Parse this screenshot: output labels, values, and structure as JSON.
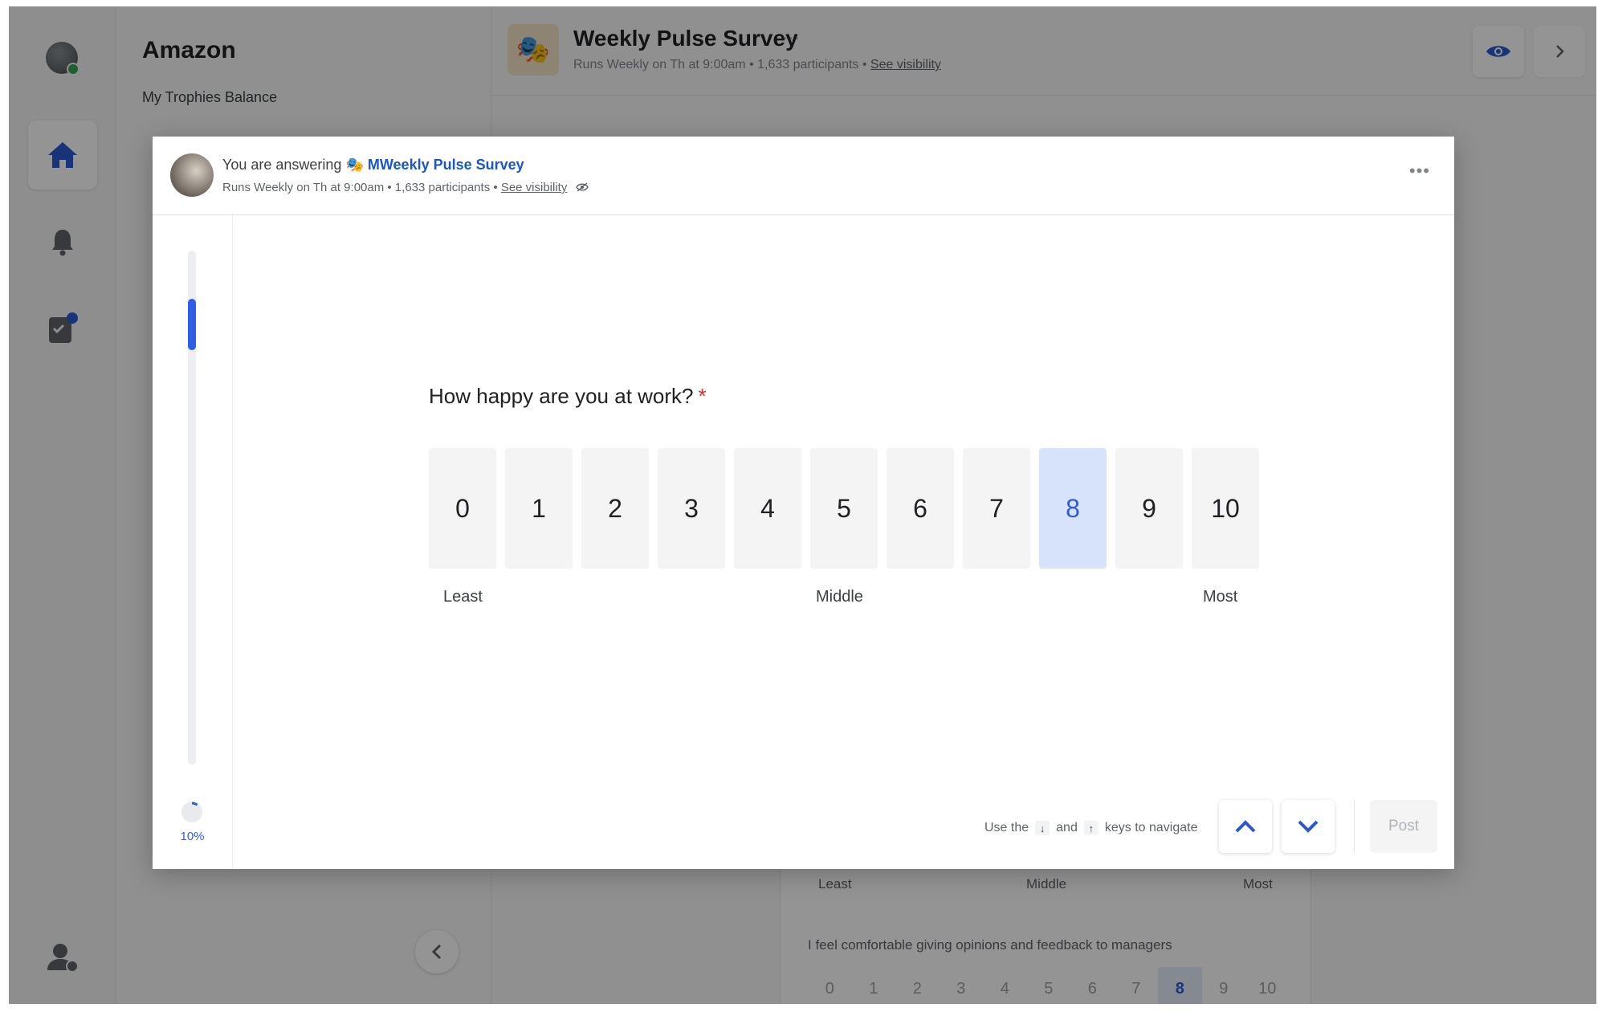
{
  "app": {
    "org_name": "Amazon",
    "trophies_label": "My Trophies Balance",
    "icons": [
      "home-icon",
      "bell-icon",
      "tasks-icon",
      "admin-icon"
    ]
  },
  "background_header": {
    "emoji": "🎭",
    "title": "Weekly Pulse Survey",
    "title_more": "···",
    "subtitle": "Runs Weekly on Th at 9:00am • 1,633 participants • ",
    "visibility_link": "See visibility"
  },
  "background_card": {
    "labels": {
      "least": "Least",
      "middle": "Middle",
      "most": "Most"
    },
    "statement": "I feel comfortable giving opinions and feedback to managers",
    "options": [
      "0",
      "1",
      "2",
      "3",
      "4",
      "5",
      "6",
      "7",
      "8",
      "9",
      "10"
    ],
    "selected": "8"
  },
  "modal": {
    "answering_prefix": "You are answering ",
    "survey_emoji": "🎭",
    "survey_name": "MWeekly Pulse Survey",
    "subtitle": "Runs Weekly on Th at 9:00am • 1,633 participants • ",
    "visibility_link": "See visibility",
    "more": "•••",
    "progress": {
      "percent": 10,
      "label": "10%"
    },
    "question": {
      "text": "How happy are you at work?",
      "required_mark": "*",
      "options": [
        "0",
        "1",
        "2",
        "3",
        "4",
        "5",
        "6",
        "7",
        "8",
        "9",
        "10"
      ],
      "selected": "8",
      "labels": {
        "least": "Least",
        "middle": "Middle",
        "most": "Most"
      }
    },
    "hint": {
      "prefix": "Use the",
      "key_down": "↓",
      "and": "and",
      "key_up": "↑",
      "suffix": "keys to navigate"
    },
    "post_label": "Post"
  },
  "colors": {
    "accent": "#2f5ee6",
    "selected_bg": "#d7e3fb",
    "required": "#d93025"
  }
}
